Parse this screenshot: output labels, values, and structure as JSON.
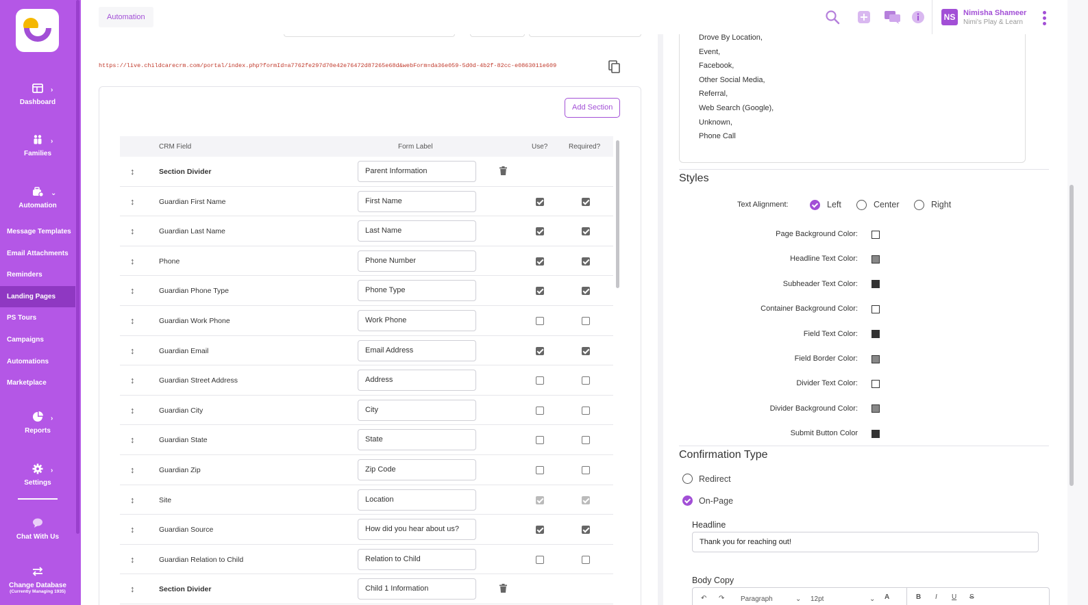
{
  "sidebar": {
    "items": [
      {
        "label": "Dashboard",
        "icon": "dashboard-icon"
      },
      {
        "label": "Families",
        "icon": "families-icon"
      },
      {
        "label": "Automation",
        "icon": "automation-icon"
      }
    ],
    "sub_items": [
      "Message Templates",
      "Email Attachments",
      "Reminders",
      "Landing Pages",
      "PS Tours",
      "Campaigns",
      "Automations",
      "Marketplace"
    ],
    "active_sub": "Landing Pages",
    "bottom_items": [
      {
        "label": "Reports",
        "icon": "reports-icon"
      },
      {
        "label": "Settings",
        "icon": "gear-icon"
      },
      {
        "label": "Chat With Us",
        "icon": "chat-icon"
      },
      {
        "label": "Change Database",
        "icon": "swap-icon"
      }
    ],
    "db_note": "(Currently Managing 1935)"
  },
  "topbar": {
    "breadcrumb": "Automation",
    "user_initials": "NS",
    "user_name": "Nimisha Shameer",
    "user_org": "Nimi's Play & Learn"
  },
  "form": {
    "url": "https://live.childcarecrm.com/portal/index.php?formId=a7762fe297d70e42e76472d87265e68d&webForm=da36e059-5d0d-4b2f-82cc-e0863011e609",
    "add_section_label": "Add Section",
    "columns": {
      "crm_field": "CRM Field",
      "form_label": "Form Label",
      "use": "Use?",
      "required": "Required?"
    },
    "rows": [
      {
        "field": "Section Divider",
        "label": "Parent Information",
        "divider": true
      },
      {
        "field": "Guardian First Name",
        "label": "First Name",
        "use": true,
        "req": true
      },
      {
        "field": "Guardian Last Name",
        "label": "Last Name",
        "use": true,
        "req": true
      },
      {
        "field": "Phone",
        "label": "Phone Number",
        "use": true,
        "req": true
      },
      {
        "field": "Guardian Phone Type",
        "label": "Phone Type",
        "use": true,
        "req": true
      },
      {
        "field": "Guardian Work Phone",
        "label": "Work Phone",
        "use": false,
        "req": false
      },
      {
        "field": "Guardian Email",
        "label": "Email Address",
        "use": true,
        "req": true
      },
      {
        "field": "Guardian Street Address",
        "label": "Address",
        "use": false,
        "req": false
      },
      {
        "field": "Guardian City",
        "label": "City",
        "use": false,
        "req": false
      },
      {
        "field": "Guardian State",
        "label": "State",
        "use": false,
        "req": false
      },
      {
        "field": "Guardian Zip",
        "label": "Zip Code",
        "use": false,
        "req": false
      },
      {
        "field": "Site",
        "label": "Location",
        "use": true,
        "req": true,
        "disabled": true
      },
      {
        "field": "Guardian Source",
        "label": "How did you hear about us?",
        "use": true,
        "req": true
      },
      {
        "field": "Guardian Relation to Child",
        "label": "Relation to Child",
        "use": false,
        "req": false
      },
      {
        "field": "Section Divider",
        "label": "Child 1 Information",
        "divider": true
      }
    ]
  },
  "sources": [
    "Drove By Location,",
    "Event,",
    "Facebook,",
    "Other Social Media,",
    "Referral,",
    "Web Search (Google),",
    "Unknown,",
    "Phone Call"
  ],
  "styles": {
    "title": "Styles",
    "alignment_label": "Text Alignment:",
    "alignment_options": [
      "Left",
      "Center",
      "Right"
    ],
    "alignment_selected": "Left",
    "colors": [
      {
        "label": "Page Background Color:",
        "color": "#ffffff"
      },
      {
        "label": "Headline Text Color:",
        "color": "#888888"
      },
      {
        "label": "Subheader Text Color:",
        "color": "#333333"
      },
      {
        "label": "Container Background Color:",
        "color": "#ffffff"
      },
      {
        "label": "Field Text Color:",
        "color": "#333333"
      },
      {
        "label": "Field Border Color:",
        "color": "#888888"
      },
      {
        "label": "Divider Text Color:",
        "color": "#ffffff"
      },
      {
        "label": "Divider Background Color:",
        "color": "#888888"
      },
      {
        "label": "Submit Button Color",
        "color": "#333333"
      }
    ]
  },
  "confirmation": {
    "title": "Confirmation Type",
    "options": [
      "Redirect",
      "On-Page"
    ],
    "selected": "On-Page",
    "headline_label": "Headline",
    "headline_value": "Thank you for reaching out!",
    "body_label": "Body Copy"
  },
  "editor": {
    "format": "Paragraph",
    "size": "12pt"
  },
  "colors": {
    "brand": "#b457e6",
    "accent": "#a24fd6"
  }
}
